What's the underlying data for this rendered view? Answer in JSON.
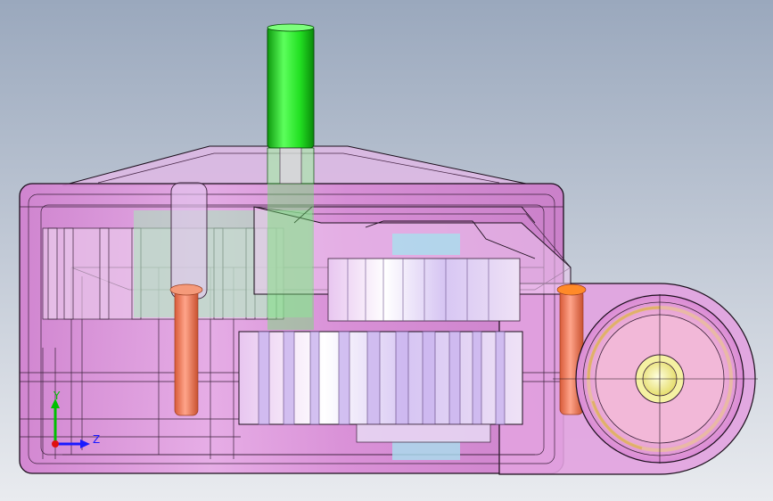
{
  "viewport": {
    "background_top": "#9aa8bd",
    "background_bottom": "#e9ebef"
  },
  "colors": {
    "housing": "#d98ad6",
    "housing_light": "#f0c4ee",
    "housing_edge": "#1b0e1b",
    "shaft_green": "#22e022",
    "shaft_green_dark": "#0e9a0e",
    "pin_orange": "#f07a56",
    "gear_white": "#f3e9f6",
    "gear_lavender": "#c5b2ee",
    "hub_peach": "#e9b9a6",
    "hub_yellow": "#f5f1a2",
    "window_green": "#a8e8b8",
    "window_cyan": "#a7e0ee"
  },
  "triad": {
    "y_axis_label": "Y",
    "z_axis_label": "Z",
    "y_color": "#00c000",
    "z_color": "#1a1aff",
    "x_color": "#e01010"
  }
}
